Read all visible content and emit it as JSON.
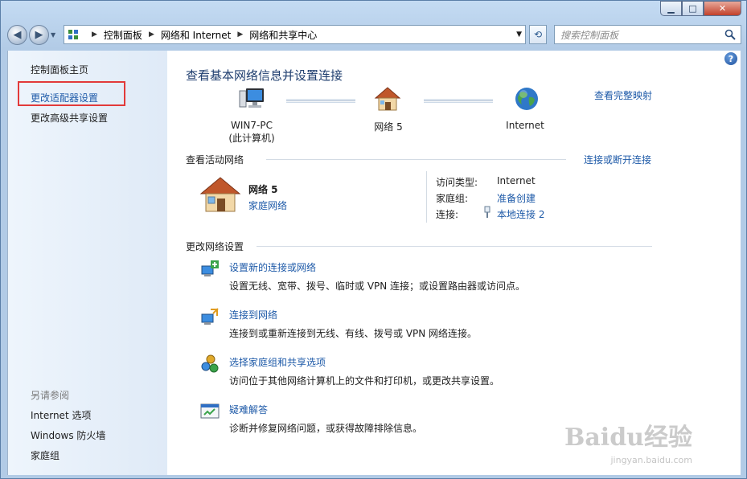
{
  "window": {
    "minimize": "▁",
    "maximize": "□",
    "close": "✕"
  },
  "nav": {
    "back": "◀",
    "forward": "▶",
    "breadcrumbs": [
      "控制面板",
      "网络和 Internet",
      "网络和共享中心"
    ],
    "search_placeholder": "搜索控制面板"
  },
  "sidebar": {
    "home": "控制面板主页",
    "adapter": "更改适配器设置",
    "advanced": "更改高级共享设置",
    "see_also_title": "另请参阅",
    "see_also": [
      "Internet 选项",
      "Windows 防火墙",
      "家庭组"
    ]
  },
  "main": {
    "title": "查看基本网络信息并设置连接",
    "full_map": "查看完整映射",
    "map": {
      "computer_name": "WIN7-PC",
      "computer_sub": "(此计算机)",
      "network": "网络  5",
      "internet": "Internet"
    },
    "active": {
      "title": "查看活动网络",
      "connect_link": "连接或断开连接",
      "name": "网络  5",
      "type": "家庭网络",
      "access_type_label": "访问类型:",
      "access_type_value": "Internet",
      "homegroup_label": "家庭组:",
      "homegroup_value": "准备创建",
      "connection_label": "连接:",
      "connection_value": "本地连接 2"
    },
    "change": {
      "title": "更改网络设置",
      "tasks": [
        {
          "link": "设置新的连接或网络",
          "desc": "设置无线、宽带、拨号、临时或 VPN 连接；或设置路由器或访问点。",
          "icon": "new-connection-icon"
        },
        {
          "link": "连接到网络",
          "desc": "连接到或重新连接到无线、有线、拨号或 VPN 网络连接。",
          "icon": "connect-network-icon"
        },
        {
          "link": "选择家庭组和共享选项",
          "desc": "访问位于其他网络计算机上的文件和打印机，或更改共享设置。",
          "icon": "homegroup-icon"
        },
        {
          "link": "疑难解答",
          "desc": "诊断并修复网络问题，或获得故障排除信息。",
          "icon": "troubleshoot-icon"
        }
      ]
    }
  },
  "watermark": {
    "brand": "Baidu经验",
    "url": "jingyan.baidu.com"
  },
  "colors": {
    "link": "#1e5aa8",
    "highlight": "#e23a3a",
    "title": "#1e3d6e"
  }
}
